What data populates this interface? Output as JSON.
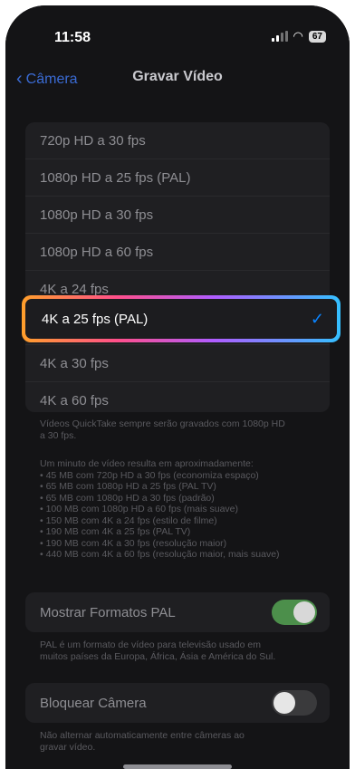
{
  "status": {
    "time": "11:58",
    "battery": "67"
  },
  "nav": {
    "back_label": "Câmera",
    "title": "Gravar Vídeo"
  },
  "formats": [
    {
      "label": "720p HD a 30 fps"
    },
    {
      "label": "1080p HD a 25 fps (PAL)"
    },
    {
      "label": "1080p HD a 30 fps"
    },
    {
      "label": "1080p HD a 60 fps"
    },
    {
      "label": "4K a 24 fps"
    },
    {
      "label": "4K a 25 fps (PAL)",
      "selected": true
    },
    {
      "label": "4K a 30 fps"
    },
    {
      "label": "4K a 60 fps"
    }
  ],
  "footnote_quicktake": [
    "Vídeos QuickTake sempre serão gravados com 1080p HD",
    "a 30 fps."
  ],
  "footnote_sizes": [
    "Um minuto de vídeo resulta em aproximadamente:",
    "• 45 MB com 720p HD a 30 fps (economiza espaço)",
    "• 65 MB com 1080p HD a 25 fps (PAL TV)",
    "• 65 MB com 1080p HD a 30 fps (padrão)",
    "• 100 MB com 1080p HD a 60 fps (mais suave)",
    "• 150 MB com 4K a 24 fps (estilo de filme)",
    "• 190 MB com 4K a 25 fps (PAL TV)",
    "• 190 MB com 4K a 30 fps (resolução maior)",
    "• 440 MB com 4K a 60 fps (resolução maior, mais suave)"
  ],
  "pal_toggle": {
    "label": "Mostrar Formatos PAL",
    "on": true
  },
  "pal_note": [
    "PAL é um formato de vídeo para televisão usado em",
    "muitos países da Europa, África, Ásia e América do Sul."
  ],
  "lock_toggle": {
    "label": "Bloquear Câmera",
    "on": false
  },
  "lock_note": [
    "Não alternar automaticamente entre câmeras ao",
    "gravar vídeo."
  ],
  "colors": {
    "accent": "#0a84ff",
    "toggle_on": "#4c8f4b",
    "toggle_off": "#3a3a3c"
  }
}
